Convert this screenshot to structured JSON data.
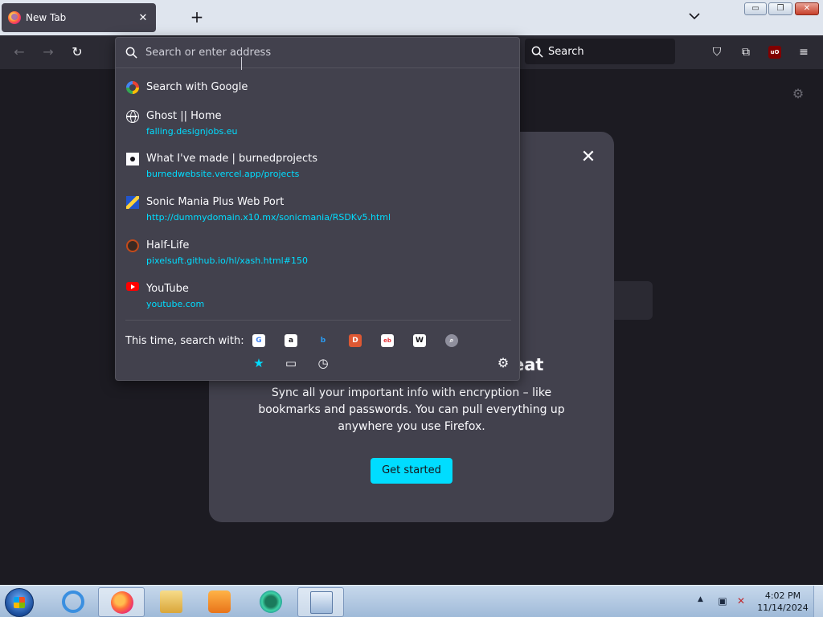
{
  "tab": {
    "title": "New Tab",
    "close_glyph": "✕"
  },
  "newtab_glyph": "+",
  "tablist_glyph": "⌄",
  "window_controls": {
    "min": "▭",
    "max": "❐",
    "close": "✕"
  },
  "nav": {
    "back": "←",
    "forward": "→",
    "reload": "↻"
  },
  "search_box": {
    "label": "Search",
    "icon": "search-icon"
  },
  "toolbar_icons": [
    "pocket-icon",
    "extensions-icon",
    "ublock-icon",
    "menu-icon"
  ],
  "toolbar_glyphs": {
    "pocket": "⛉",
    "extensions": "⧉",
    "ublock": "uO",
    "menu": "≡"
  },
  "urlbar": {
    "placeholder": "Search or enter address",
    "search_icon": "⌕"
  },
  "results": [
    {
      "icon": "google-icon",
      "title": "Search with Google",
      "url": ""
    },
    {
      "icon": "globe-icon",
      "title": "Ghost || Home",
      "url": "falling.designjobs.eu"
    },
    {
      "icon": "site-favicon",
      "title": "What I've made | burnedprojects",
      "url": "burnedwebsite.vercel.app/projects"
    },
    {
      "icon": "sonic-favicon",
      "title": "Sonic Mania Plus Web Port",
      "url": "http://dummydomain.x10.mx/sonicmania/RSDKv5.html"
    },
    {
      "icon": "halflife-favicon",
      "title": "Half-Life",
      "url": "pixelsuft.github.io/hl/xash.html#150"
    },
    {
      "icon": "youtube-icon",
      "title": "YouTube",
      "url": "youtube.com"
    }
  ],
  "search_with": {
    "label": "This time, search with:",
    "engines": [
      {
        "name": "google",
        "glyph": "G",
        "color": "#ffffff",
        "fg": "#4285f4"
      },
      {
        "name": "amazon",
        "glyph": "a",
        "color": "#ffffff",
        "fg": "#15141a"
      },
      {
        "name": "bing",
        "glyph": "b",
        "color": "#42414d",
        "fg": "#2a9df4"
      },
      {
        "name": "duckduckgo",
        "glyph": "D",
        "color": "#de5833",
        "fg": "#ffffff"
      },
      {
        "name": "ebay",
        "glyph": "eb",
        "color": "#ffffff",
        "fg": "#e53238"
      },
      {
        "name": "wikipedia",
        "glyph": "W",
        "color": "#ffffff",
        "fg": "#15141a"
      },
      {
        "name": "other",
        "glyph": "⌕",
        "color": "#8f8f9d",
        "fg": "#ffffff"
      }
    ],
    "modes": {
      "bookmarks": "★",
      "tabs": "▭",
      "history": "◷"
    },
    "gear": "⚙"
  },
  "page_gear": "⚙",
  "promo": {
    "close_glyph": "✕",
    "heading_fragment": "eat",
    "body": "Sync all your important info with encryption – like bookmarks and passwords. You can pull everything up anywhere you use Firefox.",
    "button": "Get started"
  },
  "taskbar": {
    "apps": [
      "internet-explorer",
      "firefox",
      "file-explorer",
      "media-player",
      "chrome-like-app",
      "control-panel"
    ],
    "time": "4:02 PM",
    "date": "11/14/2024",
    "tray_arrow": "▲"
  },
  "colors": {
    "accent": "#00ddff",
    "panel": "#42414d",
    "bg": "#1c1b22",
    "toolbar": "#2b2a33"
  }
}
